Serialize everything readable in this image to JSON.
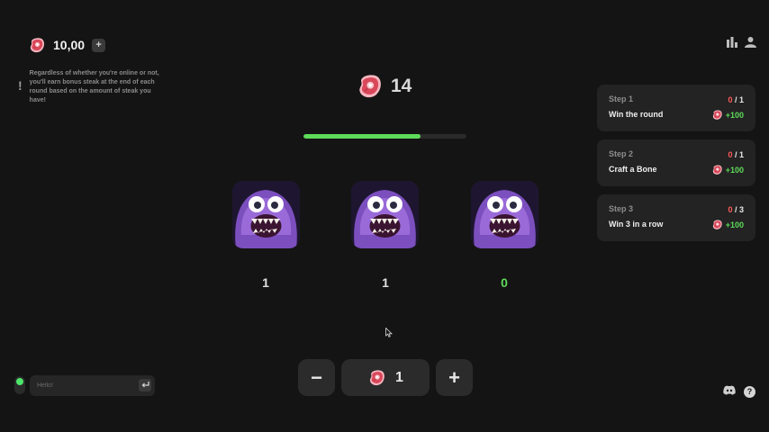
{
  "balance": {
    "value": "10,00",
    "plus_label": "+"
  },
  "info": {
    "icon": "!",
    "text": "Regardless of whether you're online or not, you'll earn bonus steak at the end of each round based on the amount of steak you have!"
  },
  "header_icons": [
    "leaderboard-icon",
    "user-icon"
  ],
  "round": {
    "steak_total": "14",
    "progress_fraction": 0.72
  },
  "monsters": [
    {
      "name": "monster-1",
      "count": "1"
    },
    {
      "name": "monster-2",
      "count": "1"
    },
    {
      "name": "monster-3",
      "count": "0"
    }
  ],
  "steps": [
    {
      "label": "Step 1",
      "current": "0",
      "total": "/ 1",
      "task": "Win the round",
      "reward": "+100"
    },
    {
      "label": "Step 2",
      "current": "0",
      "total": "/ 1",
      "task": "Craft a Bone",
      "reward": "+100"
    },
    {
      "label": "Step 3",
      "current": "0",
      "total": "/ 3",
      "task": "Win 3 in a row",
      "reward": "+100"
    }
  ],
  "controls": {
    "minus_label": "−",
    "bet_amount": "1",
    "plus_label": "+"
  },
  "chat": {
    "placeholder": "Hello!"
  },
  "colors": {
    "accent_green": "#5edb5a",
    "alert_red": "#ff5b5b",
    "monster_purple": "#8a5cc8"
  }
}
